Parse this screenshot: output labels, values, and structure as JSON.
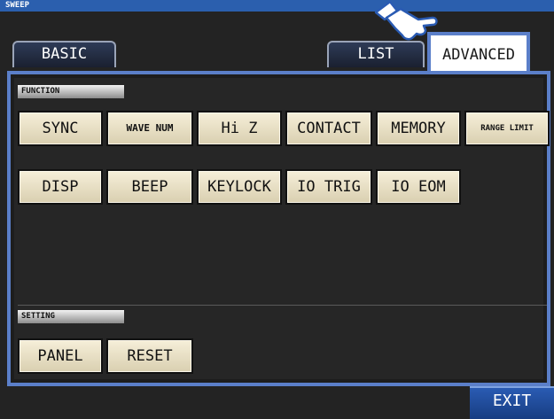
{
  "header": {
    "mode": "SWEEP"
  },
  "tabs": {
    "basic": "BASIC",
    "list": "LIST",
    "advanced": "ADVANCED"
  },
  "function_section": {
    "label": "FUNCTION",
    "buttons": [
      "SYNC",
      "WAVE NUM",
      "Hi Z",
      "CONTACT",
      "MEMORY",
      "RANGE LIMIT",
      "DISP",
      "BEEP",
      "KEYLOCK",
      "IO TRIG",
      "IO EOM"
    ]
  },
  "setting_section": {
    "label": "SETTING",
    "buttons": [
      "PANEL",
      "RESET"
    ]
  },
  "footer": {
    "exit": "EXIT"
  },
  "icons": {
    "pointer": "pointing-hand-icon"
  },
  "colors": {
    "accent": "#5b7fc9",
    "title_bar": "#2b5fae",
    "button_face": "#f2ead0",
    "exit_button": "#1f4c9e"
  }
}
